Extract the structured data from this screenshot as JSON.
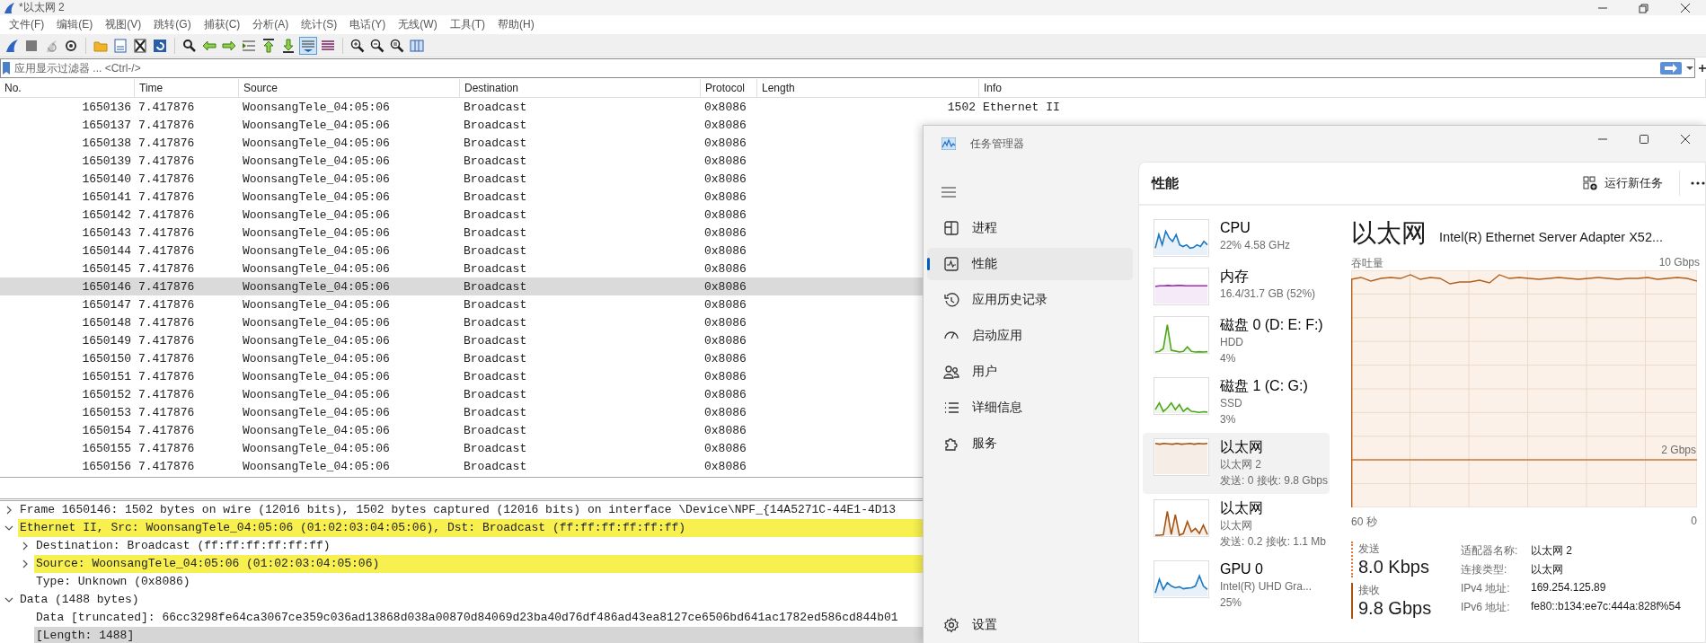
{
  "wireshark": {
    "title": "*以太网 2",
    "menu": [
      "文件(F)",
      "编辑(E)",
      "视图(V)",
      "跳转(G)",
      "捕获(C)",
      "分析(A)",
      "统计(S)",
      "电话(Y)",
      "无线(W)",
      "工具(T)",
      "帮助(H)"
    ],
    "toolbar": [
      {
        "kind": "start",
        "pressed": false
      },
      {
        "kind": "stop",
        "pressed": false
      },
      {
        "kind": "restart",
        "pressed": false
      },
      {
        "kind": "options",
        "pressed": false
      },
      {
        "kind": "open",
        "pressed": false
      },
      {
        "kind": "save",
        "pressed": false
      },
      {
        "kind": "close",
        "pressed": false
      },
      {
        "kind": "reload",
        "pressed": false
      },
      {
        "kind": "find",
        "pressed": false
      },
      {
        "kind": "back",
        "pressed": false
      },
      {
        "kind": "forward",
        "pressed": false
      },
      {
        "kind": "goto",
        "pressed": false
      },
      {
        "kind": "first",
        "pressed": false
      },
      {
        "kind": "last",
        "pressed": false
      },
      {
        "kind": "autoscroll",
        "pressed": true
      },
      {
        "kind": "colorize",
        "pressed": false
      },
      {
        "kind": "zoom-in",
        "pressed": false
      },
      {
        "kind": "zoom-out",
        "pressed": false
      },
      {
        "kind": "zoom-reset",
        "pressed": false
      },
      {
        "kind": "resize",
        "pressed": false
      }
    ],
    "filter": {
      "placeholder": "应用显示过滤器 ... <Ctrl-/>"
    },
    "columns": [
      "No.",
      "Time",
      "Source",
      "Destination",
      "Protocol",
      "Length",
      "Info"
    ],
    "rows": [
      {
        "cells": [
          "1650136",
          "7.417876",
          "WoonsangTele_04:05:06",
          "Broadcast",
          "0x8086",
          "1502",
          "Ethernet II"
        ],
        "selected": false
      },
      {
        "cells": [
          "1650137",
          "7.417876",
          "WoonsangTele_04:05:06",
          "Broadcast",
          "0x8086"
        ],
        "selected": false
      },
      {
        "cells": [
          "1650138",
          "7.417876",
          "WoonsangTele_04:05:06",
          "Broadcast",
          "0x8086"
        ],
        "selected": false
      },
      {
        "cells": [
          "1650139",
          "7.417876",
          "WoonsangTele_04:05:06",
          "Broadcast",
          "0x8086"
        ],
        "selected": false
      },
      {
        "cells": [
          "1650140",
          "7.417876",
          "WoonsangTele_04:05:06",
          "Broadcast",
          "0x8086"
        ],
        "selected": false
      },
      {
        "cells": [
          "1650141",
          "7.417876",
          "WoonsangTele_04:05:06",
          "Broadcast",
          "0x8086"
        ],
        "selected": false
      },
      {
        "cells": [
          "1650142",
          "7.417876",
          "WoonsangTele_04:05:06",
          "Broadcast",
          "0x8086"
        ],
        "selected": false
      },
      {
        "cells": [
          "1650143",
          "7.417876",
          "WoonsangTele_04:05:06",
          "Broadcast",
          "0x8086"
        ],
        "selected": false
      },
      {
        "cells": [
          "1650144",
          "7.417876",
          "WoonsangTele_04:05:06",
          "Broadcast",
          "0x8086"
        ],
        "selected": false
      },
      {
        "cells": [
          "1650145",
          "7.417876",
          "WoonsangTele_04:05:06",
          "Broadcast",
          "0x8086"
        ],
        "selected": false
      },
      {
        "cells": [
          "1650146",
          "7.417876",
          "WoonsangTele_04:05:06",
          "Broadcast",
          "0x8086"
        ],
        "selected": true
      },
      {
        "cells": [
          "1650147",
          "7.417876",
          "WoonsangTele_04:05:06",
          "Broadcast",
          "0x8086"
        ],
        "selected": false
      },
      {
        "cells": [
          "1650148",
          "7.417876",
          "WoonsangTele_04:05:06",
          "Broadcast",
          "0x8086"
        ],
        "selected": false
      },
      {
        "cells": [
          "1650149",
          "7.417876",
          "WoonsangTele_04:05:06",
          "Broadcast",
          "0x8086"
        ],
        "selected": false
      },
      {
        "cells": [
          "1650150",
          "7.417876",
          "WoonsangTele_04:05:06",
          "Broadcast",
          "0x8086"
        ],
        "selected": false
      },
      {
        "cells": [
          "1650151",
          "7.417876",
          "WoonsangTele_04:05:06",
          "Broadcast",
          "0x8086"
        ],
        "selected": false
      },
      {
        "cells": [
          "1650152",
          "7.417876",
          "WoonsangTele_04:05:06",
          "Broadcast",
          "0x8086"
        ],
        "selected": false
      },
      {
        "cells": [
          "1650153",
          "7.417876",
          "WoonsangTele_04:05:06",
          "Broadcast",
          "0x8086"
        ],
        "selected": false
      },
      {
        "cells": [
          "1650154",
          "7.417876",
          "WoonsangTele_04:05:06",
          "Broadcast",
          "0x8086"
        ],
        "selected": false
      },
      {
        "cells": [
          "1650155",
          "7.417876",
          "WoonsangTele_04:05:06",
          "Broadcast",
          "0x8086"
        ],
        "selected": false
      },
      {
        "cells": [
          "1650156",
          "7.417876",
          "WoonsangTele_04:05:06",
          "Broadcast",
          "0x8086"
        ],
        "selected": false
      }
    ],
    "details": [
      {
        "kind": "branch",
        "text": "Frame 1650146: 1502 bytes on wire (12016 bits), 1502 bytes captured (12016 bits) on interface \\Device\\NPF_{14A5271C-44E1-4D13",
        "expanded": false,
        "highlighted": false,
        "selected": false
      },
      {
        "kind": "branch",
        "text": "Ethernet II, Src: WoonsangTele_04:05:06 (01:02:03:04:05:06), Dst: Broadcast (ff:ff:ff:ff:ff:ff)",
        "expanded": true,
        "highlighted": true,
        "selected": false,
        "children": [
          {
            "kind": "branch",
            "text": "Destination: Broadcast (ff:ff:ff:ff:ff:ff)",
            "expanded": false,
            "highlighted": false,
            "selected": false
          },
          {
            "kind": "branch",
            "text": "Source: WoonsangTele_04:05:06 (01:02:03:04:05:06)",
            "expanded": false,
            "highlighted": true,
            "selected": false
          },
          {
            "kind": "leaf",
            "text": "Type: Unknown (0x8086)",
            "highlighted": false,
            "selected": false
          }
        ]
      },
      {
        "kind": "branch",
        "text": "Data (1488 bytes)",
        "expanded": true,
        "highlighted": false,
        "selected": false,
        "children": [
          {
            "kind": "leaf",
            "text": "Data [truncated]: 66cc3298fe64ca3067ce359c036ad13868d038a00870d84069d23ba40d76df486ad43ea8127ce6506bd641ac1782ed586cd844b01",
            "highlighted": false,
            "selected": false
          },
          {
            "kind": "leaf",
            "text": "[Length: 1488]",
            "highlighted": false,
            "selected": true
          }
        ]
      }
    ]
  },
  "task_manager": {
    "title": "任务管理器",
    "nav": [
      {
        "label": "进程",
        "selected": false
      },
      {
        "label": "性能",
        "selected": true
      },
      {
        "label": "应用历史记录",
        "selected": false
      },
      {
        "label": "启动应用",
        "selected": false
      },
      {
        "label": "用户",
        "selected": false
      },
      {
        "label": "详细信息",
        "selected": false
      },
      {
        "label": "服务",
        "selected": false
      }
    ],
    "settings": "设置",
    "header": {
      "title": "性能",
      "run_task": "运行新任务"
    },
    "resources": [
      {
        "title": "CPU",
        "lines": [
          "22%  4.58 GHz"
        ],
        "color": "#1979c3",
        "selected": false
      },
      {
        "title": "内存",
        "lines": [
          "16.4/31.7 GB (52%)"
        ],
        "color": "#9a2fb0",
        "selected": false
      },
      {
        "title": "磁盘 0 (D: E: F:)",
        "lines": [
          "HDD",
          "4%"
        ],
        "color": "#4ea51a",
        "selected": false
      },
      {
        "title": "磁盘 1 (C: G:)",
        "lines": [
          "SSD",
          "3%"
        ],
        "color": "#4ea51a",
        "selected": false
      },
      {
        "title": "以太网",
        "lines": [
          "以太网 2",
          "发送: 0 接收: 9.8 Gbps"
        ],
        "color": "#a7520f",
        "selected": true
      },
      {
        "title": "以太网",
        "lines": [
          "以太网",
          "发送: 0.2 接收: 1.1 Mb"
        ],
        "color": "#a7520f",
        "selected": false
      },
      {
        "title": "GPU 0",
        "lines": [
          "Intel(R) UHD Gra...",
          "25%"
        ],
        "color": "#1979c3",
        "selected": false
      }
    ],
    "detail": {
      "title": "以太网",
      "adapter": "Intel(R) Ethernet Server Adapter X52...",
      "graph_label": "吞吐量",
      "graph_max": "10 Gbps",
      "graph_mark": "2 Gbps",
      "time_start": "60 秒",
      "time_end": "0",
      "rates": [
        {
          "kind": "send",
          "label": "发送",
          "value": "8.0 Kbps"
        },
        {
          "kind": "receive",
          "label": "接收",
          "value": "9.8 Gbps"
        }
      ],
      "properties": [
        {
          "label": "适配器名称:",
          "value": "以太网 2"
        },
        {
          "label": "连接类型:",
          "value": "以太网"
        },
        {
          "label": "IPv4 地址:",
          "value": "169.254.125.89"
        },
        {
          "label": "IPv6 地址:",
          "value": "fe80::b134:ee7c:444a:828f%54"
        }
      ]
    }
  }
}
